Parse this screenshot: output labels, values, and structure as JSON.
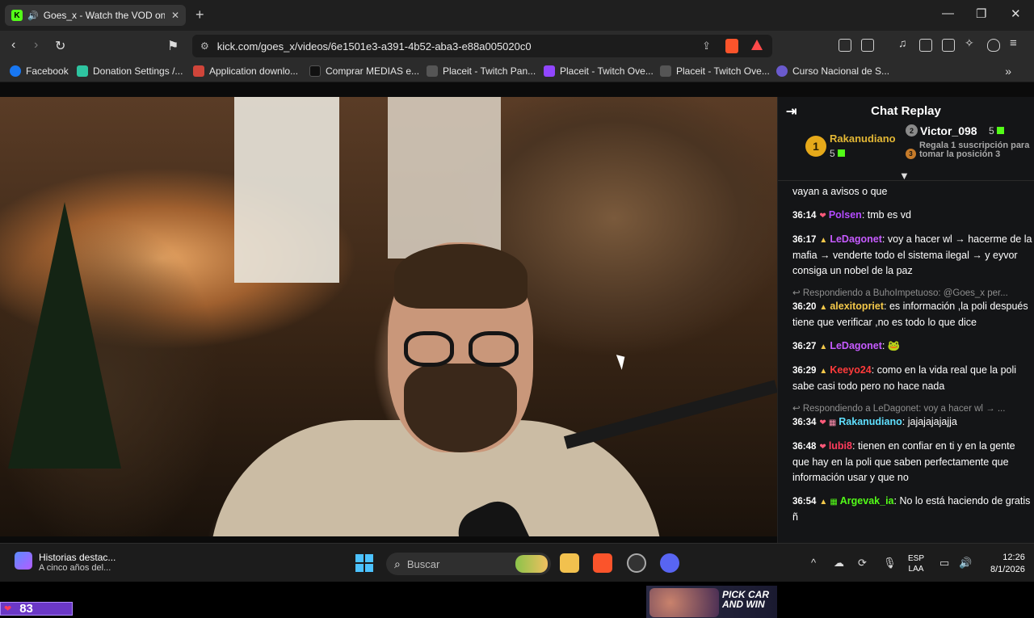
{
  "browser": {
    "tab_title": "Goes_x - Watch the VOD on K",
    "tab_favicon": "K",
    "new_tab": "+",
    "url": "kick.com/goes_x/videos/6e1501e3-a391-4b52-aba3-e88a005020c0",
    "bookmarks": [
      {
        "label": "Facebook",
        "color": "#1877f2"
      },
      {
        "label": "Donation Settings /...",
        "color": "#2ec4a0"
      },
      {
        "label": "Application downlo...",
        "color": "#d0453a"
      },
      {
        "label": "Comprar MEDIAS e...",
        "color": "#111111"
      },
      {
        "label": "Placeit - Twitch Pan...",
        "color": "#555555"
      },
      {
        "label": "Placeit - Twitch Ove...",
        "color": "#9146ff"
      },
      {
        "label": "Placeit - Twitch Ove...",
        "color": "#555555"
      },
      {
        "label": "Curso Nacional de S...",
        "color": "#6a5acd"
      }
    ]
  },
  "video": {
    "viewer_count": "83",
    "promo_text_1": "PICK CAR",
    "promo_text_2": "AND WIN"
  },
  "chat": {
    "title": "Chat Replay",
    "leaderboard": {
      "first_rank": "1",
      "first_name": "Rakanudiano",
      "first_subs": "5",
      "second_rank": "2",
      "second_name": "Victor_098",
      "second_subs": "5",
      "third_rank": "3",
      "third_promo": "Regala 1 suscripción para tomar la posición 3"
    },
    "messages": [
      {
        "time": "",
        "user": "",
        "user_color": "#ffffff",
        "text": "vayan a avisos o que"
      },
      {
        "time": "36:14",
        "user": "Polsen",
        "user_color": "#b44bff",
        "text": "tmb es vd"
      },
      {
        "time": "36:17",
        "user": "LeDagonet",
        "user_color": "#c65bff",
        "text": "voy a hacer wl → hacerme de la mafia → venderte todo el sistema ilegal → y eyvor consiga un nobel de la paz"
      },
      {
        "time": "36:20",
        "user": "alexitopriet",
        "user_color": "#f3c84a",
        "text": "es información ,la poli después tiene que verificar ,no es todo lo que dice",
        "reply": "Respondiendo a BuhoImpetuoso: @Goes_x per..."
      },
      {
        "time": "36:27",
        "user": "LeDagonet",
        "user_color": "#c65bff",
        "text": "🐸"
      },
      {
        "time": "36:29",
        "user": "Keeyo24",
        "user_color": "#ff3b3b",
        "text": "como en la vida real que la poli sabe casi todo pero no hace nada"
      },
      {
        "time": "36:34",
        "user": "Rakanudiano",
        "user_color": "#5fe0ff",
        "text": "jajajajajajja",
        "reply": "Respondiendo a LeDagonet: voy a hacer wl → ..."
      },
      {
        "time": "36:48",
        "user": "lubi8",
        "user_color": "#ff3b5c",
        "text": "tienen en confiar en ti y en la gente que hay en la poli que saben perfectamente que información usar y que no"
      },
      {
        "time": "36:54",
        "user": "Argevak_ia",
        "user_color": "#53fc18",
        "text": "No lo está haciendo de gratis ñ"
      }
    ]
  },
  "taskbar": {
    "news_title": "Historias destac...",
    "news_subtitle": "A cinco años del...",
    "search_placeholder": "Buscar",
    "lang_1": "ESP",
    "lang_2": "LAA",
    "time": "12:26",
    "date": "8/1/2026"
  }
}
